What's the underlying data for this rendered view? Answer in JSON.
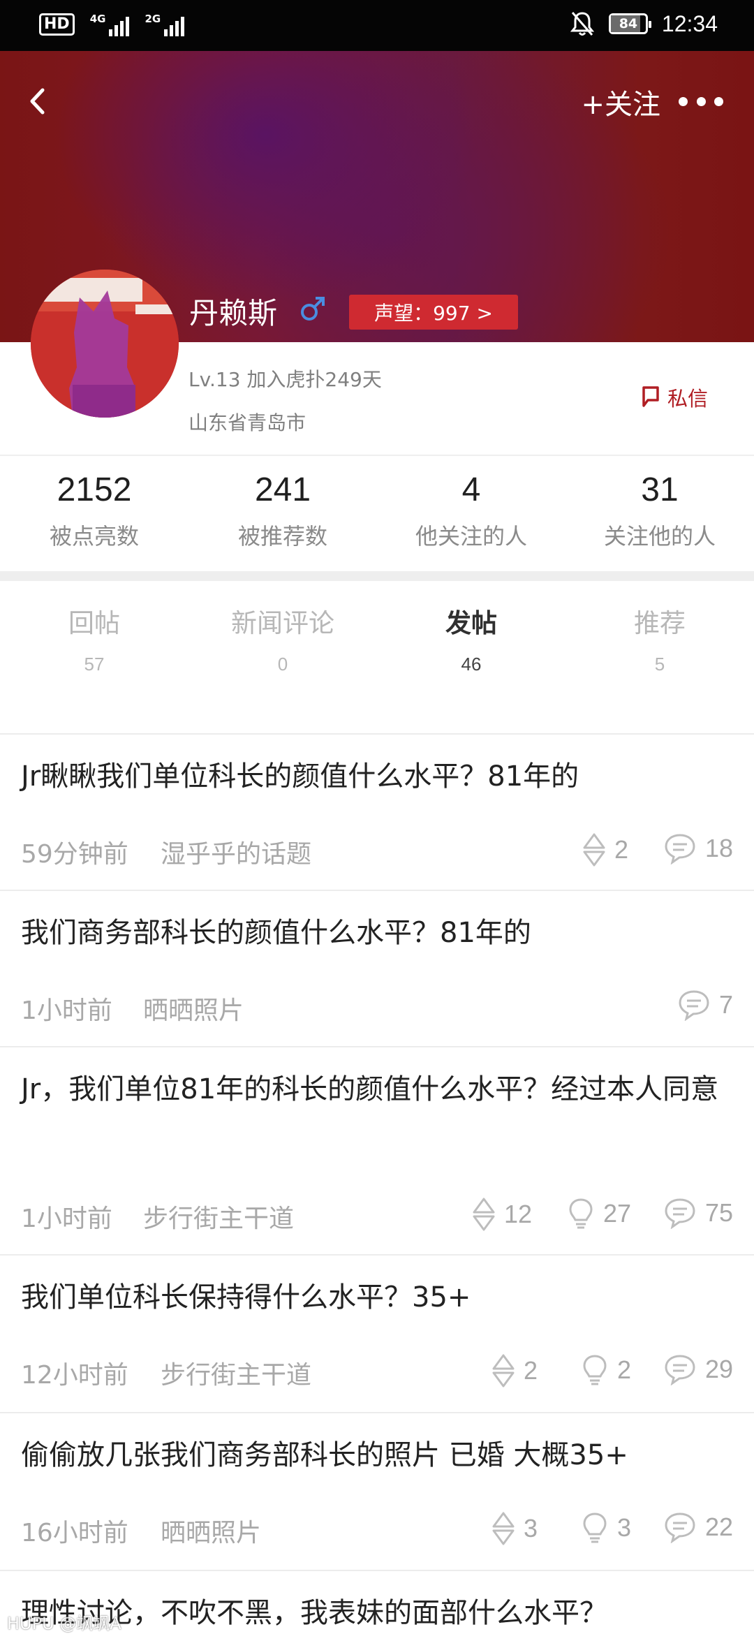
{
  "status_bar": {
    "hd": "HD",
    "net1": "4G",
    "net2": "2G",
    "battery": "84",
    "battery_level": 0.84,
    "time": "12:34"
  },
  "header": {
    "follow_label": "+关注"
  },
  "profile": {
    "username": "丹赖斯",
    "gender_icon": "male-symbol",
    "reputation": "声望：997 >",
    "level_info": "Lv.13  加入虎扑249天",
    "location": "山东省青岛市",
    "message_label": "私信"
  },
  "stats": [
    {
      "value": "2152",
      "label": "被点亮数"
    },
    {
      "value": "241",
      "label": "被推荐数"
    },
    {
      "value": "4",
      "label": "他关注的人"
    },
    {
      "value": "31",
      "label": "关注他的人"
    }
  ],
  "tabs": [
    {
      "label": "回帖",
      "count": "57"
    },
    {
      "label": "新闻评论",
      "count": "0"
    },
    {
      "label": "发帖",
      "count": "46",
      "active": true
    },
    {
      "label": "推荐",
      "count": "5"
    }
  ],
  "posts": [
    {
      "title": "Jr瞅瞅我们单位科长的颜值什么水平？81年的",
      "time": "59分钟前",
      "topic": "湿乎乎的话题",
      "recommends": "2",
      "lights": null,
      "replies": "18"
    },
    {
      "title": "我们商务部科长的颜值什么水平？81年的",
      "time": "1小时前",
      "topic": "晒晒照片",
      "recommends": null,
      "lights": null,
      "replies": "7"
    },
    {
      "title": "Jr，我们单位81年的科长的颜值什么水平？经过本人同意",
      "time": "1小时前",
      "topic": "步行街主干道",
      "recommends": "12",
      "lights": "27",
      "replies": "75"
    },
    {
      "title": "我们单位科长保持得什么水平？35+",
      "time": "12小时前",
      "topic": "步行街主干道",
      "recommends": "2",
      "lights": "2",
      "replies": "29"
    },
    {
      "title": "偷偷放几张我们商务部科长的照片 已婚 大概35+",
      "time": "16小时前",
      "topic": "晒晒照片",
      "recommends": "3",
      "lights": "3",
      "replies": "22"
    },
    {
      "title": "理性讨论，不吹不黑，我表妹的面部什么水平？",
      "time": "",
      "topic": "",
      "recommends": null,
      "lights": null,
      "replies": null
    }
  ],
  "watermark": "HUPU @飒飒A",
  "colors": {
    "accent_red": "#cf2a31",
    "dm_red": "#b01e24",
    "banner_base": "#7a1515",
    "banner_purple": "#5a1464",
    "gender_blue": "#4a8de0"
  }
}
